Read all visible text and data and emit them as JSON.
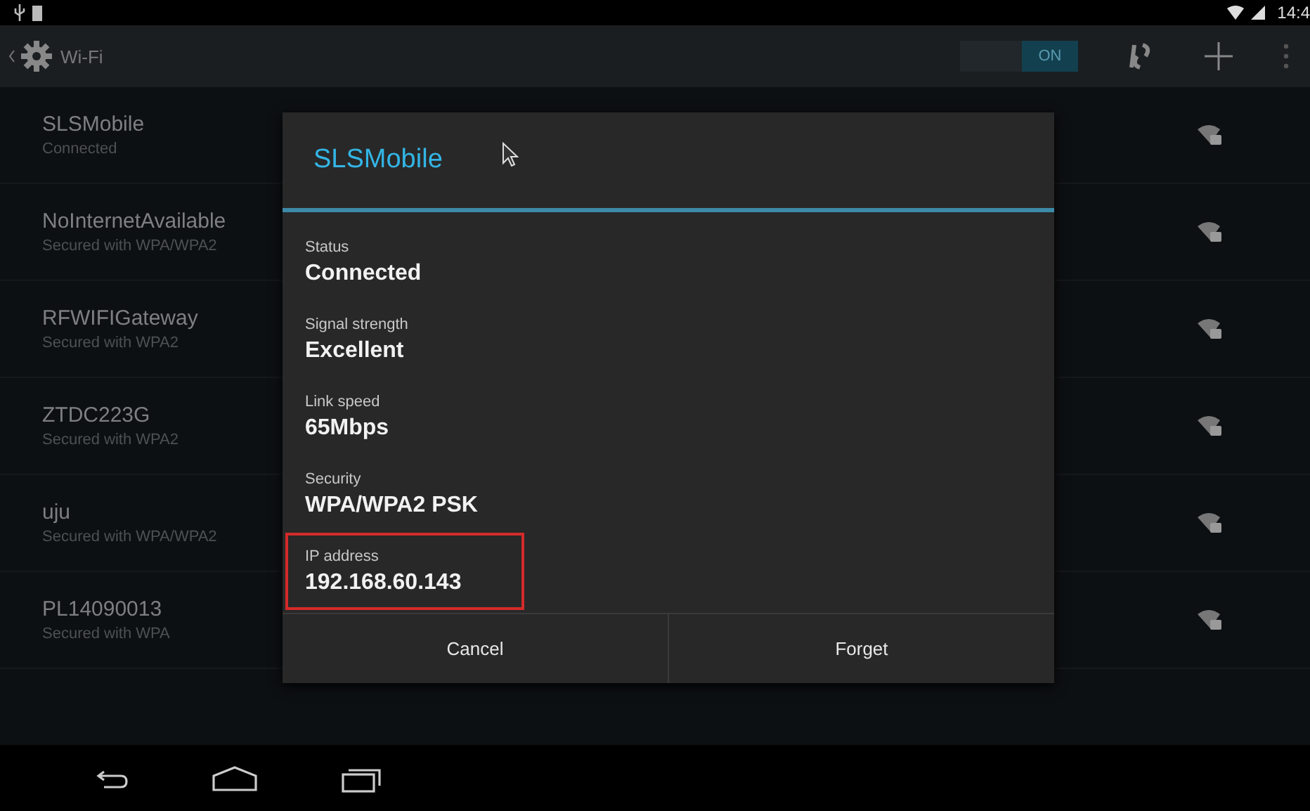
{
  "status_bar": {
    "time": "14:4"
  },
  "action_bar": {
    "title": "Wi-Fi",
    "toggle": {
      "label": "ON",
      "on": true
    }
  },
  "networks": [
    {
      "name": "SLSMobile",
      "status": "Connected"
    },
    {
      "name": "NoInternetAvailable",
      "status": "Secured with WPA/WPA2"
    },
    {
      "name": "RFWIFIGateway",
      "status": "Secured with WPA2"
    },
    {
      "name": "ZTDC223G",
      "status": "Secured with WPA2"
    },
    {
      "name": "uju",
      "status": "Secured with WPA/WPA2"
    },
    {
      "name": "PL14090013",
      "status": "Secured with WPA"
    }
  ],
  "dialog": {
    "title": "SLSMobile",
    "fields": [
      {
        "label": "Status",
        "value": "Connected",
        "highlighted": false
      },
      {
        "label": "Signal strength",
        "value": "Excellent",
        "highlighted": false
      },
      {
        "label": "Link speed",
        "value": "65Mbps",
        "highlighted": false
      },
      {
        "label": "Security",
        "value": "WPA/WPA2 PSK",
        "highlighted": false
      },
      {
        "label": "IP address",
        "value": "192.168.60.143",
        "highlighted": true
      }
    ],
    "buttons": [
      "Cancel",
      "Forget"
    ]
  }
}
